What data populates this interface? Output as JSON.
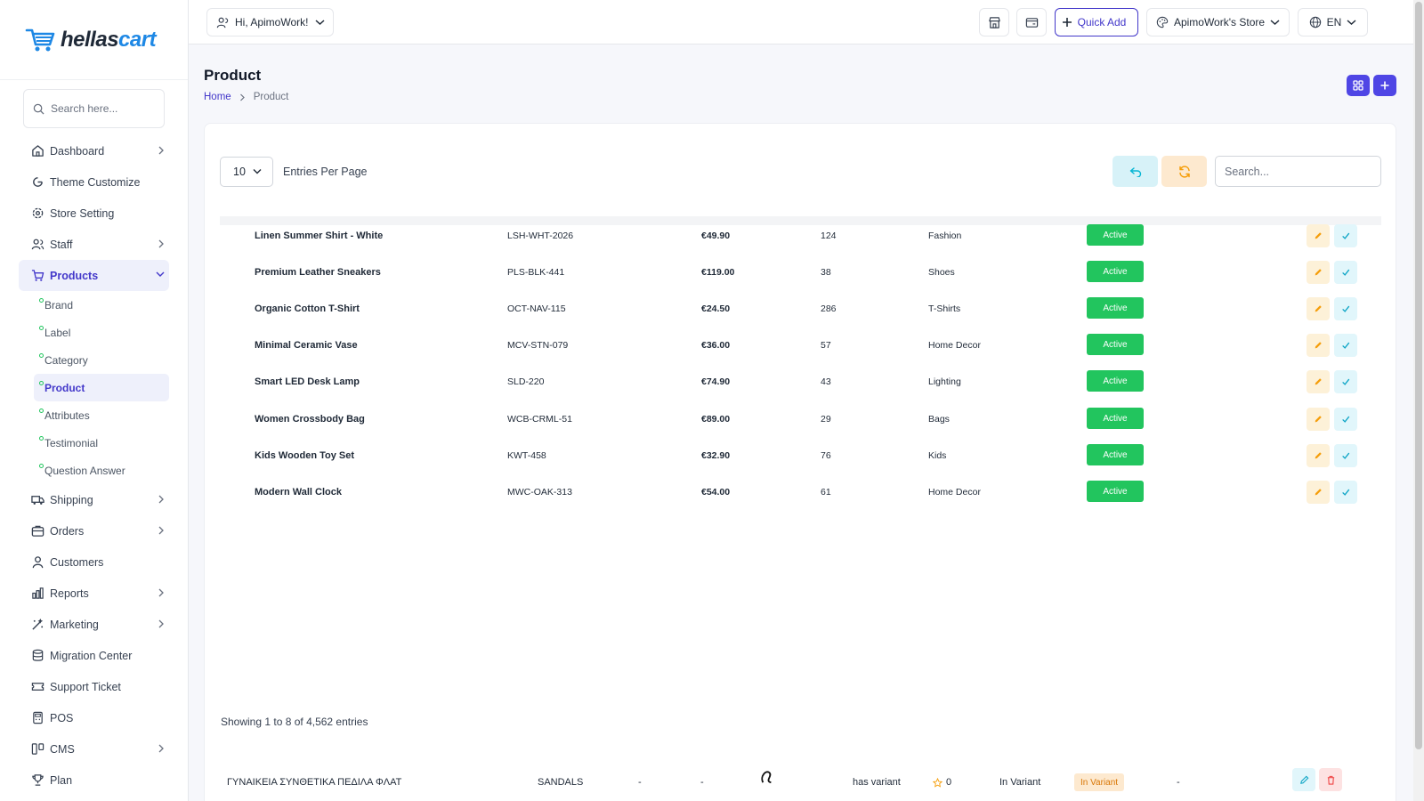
{
  "brand": {
    "name_part1": "hellas",
    "name_part2": "cart"
  },
  "sidebar": {
    "search_placeholder": "Search here...",
    "items": [
      {
        "label": "Dashboard",
        "icon": "home-icon",
        "chevron": true
      },
      {
        "label": "Theme Customize",
        "icon": "theme-icon",
        "chevron": false
      },
      {
        "label": "Store Setting",
        "icon": "settings-icon",
        "chevron": false
      },
      {
        "label": "Staff",
        "icon": "users-icon",
        "chevron": true
      },
      {
        "label": "Products",
        "icon": "cart-icon",
        "chevron": true,
        "active": true
      },
      {
        "label": "Shipping",
        "icon": "truck-icon",
        "chevron": true
      },
      {
        "label": "Orders",
        "icon": "box-icon",
        "chevron": true
      },
      {
        "label": "Customers",
        "icon": "user-icon",
        "chevron": false
      },
      {
        "label": "Reports",
        "icon": "chart-icon",
        "chevron": true
      },
      {
        "label": "Marketing",
        "icon": "marketing-icon",
        "chevron": true
      },
      {
        "label": "Migration Center",
        "icon": "database-icon",
        "chevron": false
      },
      {
        "label": "Support Ticket",
        "icon": "ticket-icon",
        "chevron": false
      },
      {
        "label": "POS",
        "icon": "pos-icon",
        "chevron": false
      },
      {
        "label": "CMS",
        "icon": "cms-icon",
        "chevron": true
      },
      {
        "label": "Plan",
        "icon": "trophy-icon",
        "chevron": false
      }
    ],
    "products_submenu": [
      "Brand",
      "Label",
      "Category",
      "Product",
      "Attributes",
      "Testimonial",
      "Question Answer"
    ],
    "active_submenu": "Product"
  },
  "header": {
    "greeting": "Hi, ApimoWork!",
    "quick_add": "Quick Add",
    "store": "ApimoWork's Store",
    "language": "EN"
  },
  "page": {
    "title": "Product",
    "breadcrumb_home": "Home",
    "breadcrumb_current": "Product"
  },
  "table": {
    "per_page_value": "10",
    "per_page_label": "Entries Per Page",
    "search_placeholder": "Search...",
    "rows": [
      {
        "name": "Linen Summer Shirt - White",
        "sku": "LSH-WHT-2026",
        "price": "€49.90",
        "stock": "124",
        "category": "Fashion",
        "status": "Active"
      },
      {
        "name": "Premium Leather Sneakers",
        "sku": "PLS-BLK-441",
        "price": "€119.00",
        "stock": "38",
        "category": "Shoes",
        "status": "Active"
      },
      {
        "name": "Organic Cotton T-Shirt",
        "sku": "OCT-NAV-115",
        "price": "€24.50",
        "stock": "286",
        "category": "T-Shirts",
        "status": "Active"
      },
      {
        "name": "Minimal Ceramic Vase",
        "sku": "MCV-STN-079",
        "price": "€36.00",
        "stock": "57",
        "category": "Home Decor",
        "status": "Active"
      },
      {
        "name": "Smart LED Desk Lamp",
        "sku": "SLD-220",
        "price": "€74.90",
        "stock": "43",
        "category": "Lighting",
        "status": "Active"
      },
      {
        "name": "Women Crossbody Bag",
        "sku": "WCB-CRML-51",
        "price": "€89.00",
        "stock": "29",
        "category": "Bags",
        "status": "Active"
      },
      {
        "name": "Kids Wooden Toy Set",
        "sku": "KWT-458",
        "price": "€32.90",
        "stock": "76",
        "category": "Kids",
        "status": "Active"
      },
      {
        "name": "Modern Wall Clock",
        "sku": "MWC-OAK-313",
        "price": "€54.00",
        "stock": "61",
        "category": "Home Decor",
        "status": "Active"
      }
    ],
    "showing": "Showing 1 to 8 of 4,562 entries",
    "ghost_row": {
      "name": "ΓΥΝΑΙΚΕΙΑ ΣΥΝΘΕΤΙΚΑ ΠΕΔΙΛΑ ΦΛΑΤ",
      "category": "SANDALS",
      "col3": "-",
      "col4": "-",
      "variant": "has variant",
      "rating": "0",
      "stock_type": "In Variant",
      "badge": "In Variant",
      "col9": "-"
    }
  },
  "colors": {
    "accent": "#4338ca",
    "active_status": "#22c55e",
    "undo_bg": "#d7f2f8",
    "refresh_bg": "#fde9cf"
  }
}
